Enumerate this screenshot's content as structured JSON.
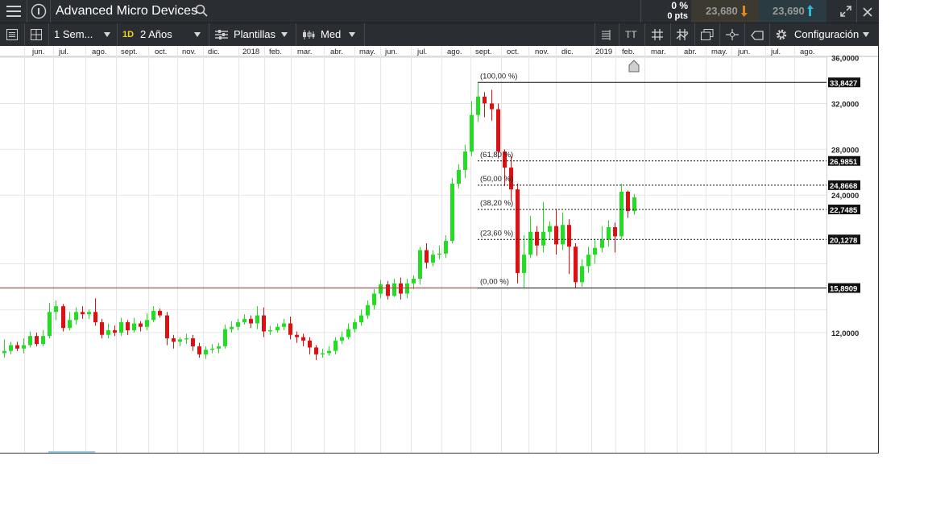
{
  "header": {
    "title": "Advanced Micro Devices",
    "change_percent": "0 %",
    "change_points": "0 pts",
    "sell_price": "23,680",
    "buy_price": "23,690",
    "sell_color": "#e08a1e",
    "buy_color": "#2fb9d6"
  },
  "toolbar": {
    "interval": "1 Sem...",
    "timeframe_badge": "1D",
    "range": "2 Años",
    "templates_label": "Plantillas",
    "indicator_label": "Med",
    "text_tool": "TT",
    "settings_label": "Configuración"
  },
  "chart_data": {
    "type": "candlestick",
    "x_ticks": [
      "jun.",
      "jul.",
      "ago.",
      "sept.",
      "oct.",
      "nov.",
      "dic.",
      "2018",
      "feb.",
      "mar.",
      "abr.",
      "may.",
      "jun.",
      "jul.",
      "ago.",
      "sept.",
      "oct.",
      "nov.",
      "dic.",
      "2019",
      "feb.",
      "mar.",
      "abr.",
      "may.",
      "jun.",
      "jul.",
      "ago."
    ],
    "y_ticks": [
      "36,0000",
      "32,0000",
      "28,0000",
      "24,0000",
      "12,0000"
    ],
    "ylim": [
      7.5,
      36.5
    ],
    "up_color": "#22dd22",
    "down_color": "#dd1111",
    "horizontal_line": {
      "value": 15.8909,
      "label": "15,8909",
      "color": "#dd2222"
    },
    "fib_levels": [
      {
        "value": 33.8427,
        "label": "(100,00 %)",
        "price": "33,8427"
      },
      {
        "value": 26.9851,
        "label": "(61,80 %)",
        "price": "26,9851"
      },
      {
        "value": 24.8668,
        "label": "(50,00 %)",
        "price": "24,8668"
      },
      {
        "value": 22.7485,
        "label": "(38,20 %)",
        "price": "22,7485"
      },
      {
        "value": 20.1278,
        "label": "(23,60 %)",
        "price": "20,1278"
      },
      {
        "value": 15.8909,
        "label": "(0,00 %)",
        "price": "15,8909"
      }
    ],
    "candles": [
      [
        10.2,
        10.4,
        11.4,
        9.8
      ],
      [
        10.4,
        10.9,
        11.2,
        10.1
      ],
      [
        10.9,
        10.6,
        11.2,
        10.4
      ],
      [
        10.6,
        10.9,
        11.5,
        10.2
      ],
      [
        10.9,
        11.7,
        12.1,
        10.7
      ],
      [
        11.7,
        11.0,
        12.0,
        10.8
      ],
      [
        11.0,
        11.7,
        12.2,
        10.8
      ],
      [
        11.7,
        13.8,
        14.6,
        11.5
      ],
      [
        13.8,
        14.3,
        14.8,
        13.1
      ],
      [
        14.3,
        12.4,
        14.5,
        12.1
      ],
      [
        12.4,
        13.1,
        13.8,
        12.2
      ],
      [
        13.1,
        13.8,
        14.2,
        12.7
      ],
      [
        13.8,
        13.6,
        14.3,
        13.2
      ],
      [
        13.6,
        13.8,
        14.0,
        13.2
      ],
      [
        13.8,
        12.9,
        15.0,
        12.6
      ],
      [
        12.9,
        11.8,
        13.2,
        11.5
      ],
      [
        11.8,
        12.2,
        12.8,
        11.5
      ],
      [
        12.2,
        12.0,
        12.6,
        11.7
      ],
      [
        12.0,
        12.9,
        13.3,
        11.7
      ],
      [
        12.9,
        12.2,
        13.1,
        11.8
      ],
      [
        12.2,
        12.8,
        13.3,
        12.0
      ],
      [
        12.8,
        12.5,
        13.0,
        12.1
      ],
      [
        12.5,
        13.1,
        13.7,
        12.2
      ],
      [
        13.1,
        13.9,
        14.3,
        12.9
      ],
      [
        13.9,
        13.5,
        14.1,
        13.3
      ],
      [
        13.5,
        11.5,
        13.8,
        10.9
      ],
      [
        11.5,
        11.2,
        11.8,
        10.6
      ],
      [
        11.2,
        11.4,
        11.6,
        10.8
      ],
      [
        11.4,
        11.5,
        11.9,
        11.0
      ],
      [
        11.5,
        10.8,
        11.8,
        10.4
      ],
      [
        10.8,
        10.1,
        11.1,
        9.8
      ],
      [
        10.1,
        10.5,
        10.8,
        9.7
      ],
      [
        10.5,
        10.6,
        11.0,
        10.2
      ],
      [
        10.6,
        10.8,
        11.1,
        10.2
      ],
      [
        10.8,
        12.3,
        12.7,
        10.6
      ],
      [
        12.3,
        12.5,
        13.0,
        12.0
      ],
      [
        12.5,
        12.9,
        13.2,
        12.2
      ],
      [
        12.9,
        13.2,
        13.6,
        12.7
      ],
      [
        13.2,
        12.8,
        13.5,
        12.4
      ],
      [
        12.8,
        13.5,
        14.3,
        12.3
      ],
      [
        13.5,
        12.1,
        14.2,
        11.6
      ],
      [
        12.1,
        12.2,
        12.6,
        11.8
      ],
      [
        12.2,
        12.5,
        12.8,
        12.0
      ],
      [
        12.5,
        12.8,
        13.2,
        12.2
      ],
      [
        12.8,
        11.8,
        13.4,
        11.4
      ],
      [
        11.8,
        11.6,
        12.1,
        11.1
      ],
      [
        11.6,
        11.3,
        11.9,
        10.8
      ],
      [
        11.3,
        10.7,
        11.6,
        10.1
      ],
      [
        10.7,
        10.1,
        10.9,
        9.6
      ],
      [
        10.1,
        10.2,
        10.6,
        9.8
      ],
      [
        10.2,
        10.4,
        10.8,
        10.0
      ],
      [
        10.4,
        11.3,
        11.6,
        10.1
      ],
      [
        11.3,
        11.6,
        12.1,
        11.0
      ],
      [
        11.6,
        12.3,
        12.8,
        11.4
      ],
      [
        12.3,
        12.9,
        13.2,
        12.0
      ],
      [
        12.9,
        13.5,
        14.0,
        12.6
      ],
      [
        13.5,
        14.4,
        14.8,
        13.2
      ],
      [
        14.4,
        15.4,
        15.8,
        14.0
      ],
      [
        15.4,
        16.2,
        16.6,
        15.0
      ],
      [
        16.2,
        15.2,
        16.5,
        14.9
      ],
      [
        15.2,
        16.3,
        16.7,
        15.1
      ],
      [
        16.3,
        15.4,
        16.8,
        14.9
      ],
      [
        15.4,
        16.3,
        16.7,
        15.0
      ],
      [
        16.3,
        16.7,
        17.0,
        15.8
      ],
      [
        16.7,
        19.2,
        19.5,
        16.2
      ],
      [
        19.2,
        18.1,
        19.8,
        17.6
      ],
      [
        18.1,
        18.8,
        19.2,
        17.8
      ],
      [
        18.8,
        18.9,
        19.6,
        18.4
      ],
      [
        18.9,
        20.0,
        20.5,
        18.5
      ],
      [
        20.0,
        25.0,
        25.5,
        19.8
      ],
      [
        25.0,
        26.2,
        26.7,
        24.6
      ],
      [
        26.2,
        27.8,
        28.4,
        25.5
      ],
      [
        27.8,
        31.0,
        32.2,
        27.4
      ],
      [
        31.0,
        32.6,
        33.8,
        30.4
      ],
      [
        32.6,
        32.0,
        33.0,
        30.8
      ],
      [
        32.0,
        31.5,
        33.2,
        30.5
      ],
      [
        31.5,
        27.8,
        32.0,
        27.2
      ],
      [
        27.8,
        26.4,
        28.0,
        24.8
      ],
      [
        26.4,
        24.5,
        27.4,
        23.5
      ],
      [
        24.5,
        17.2,
        25.0,
        16.3
      ],
      [
        17.2,
        18.8,
        20.5,
        15.9
      ],
      [
        18.8,
        20.8,
        22.2,
        18.5
      ],
      [
        20.8,
        19.6,
        21.3,
        18.7
      ],
      [
        19.6,
        20.8,
        23.4,
        19.0
      ],
      [
        20.8,
        21.3,
        21.7,
        20.1
      ],
      [
        21.3,
        19.7,
        22.8,
        18.8
      ],
      [
        19.7,
        21.4,
        22.5,
        19.2
      ],
      [
        21.4,
        19.5,
        21.9,
        17.1
      ],
      [
        19.5,
        16.4,
        19.8,
        15.9
      ],
      [
        16.4,
        17.8,
        18.4,
        16.0
      ],
      [
        17.8,
        18.8,
        19.5,
        17.2
      ],
      [
        18.8,
        19.4,
        20.2,
        18.0
      ],
      [
        19.4,
        20.1,
        21.3,
        19.0
      ],
      [
        20.1,
        21.2,
        21.8,
        19.5
      ],
      [
        21.2,
        20.4,
        21.6,
        19.0
      ],
      [
        20.4,
        24.3,
        25.0,
        20.1
      ],
      [
        24.3,
        22.6,
        24.4,
        22.0
      ],
      [
        22.6,
        23.8,
        24.1,
        22.3
      ]
    ]
  }
}
